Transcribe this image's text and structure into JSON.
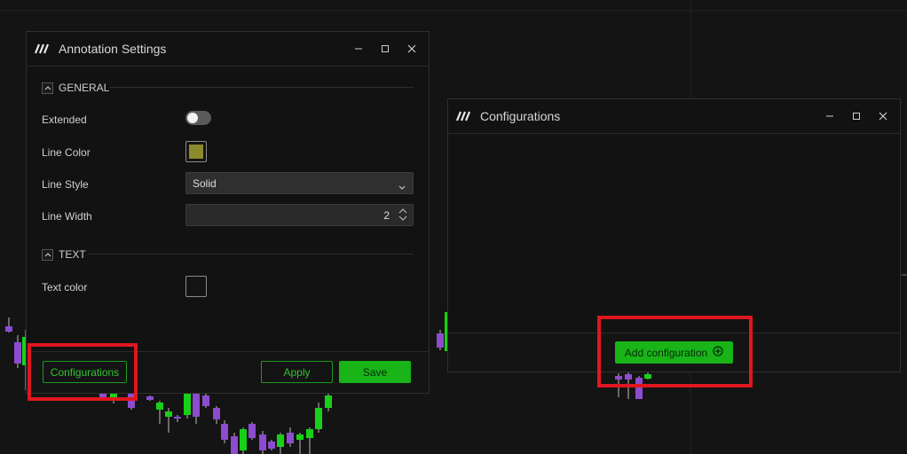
{
  "annotation_settings": {
    "title": "Annotation Settings",
    "logo_icon": "app-logo-icon",
    "sections": {
      "general": {
        "label": "GENERAL"
      },
      "text": {
        "label": "TEXT"
      }
    },
    "fields": {
      "extended": {
        "label": "Extended",
        "value": false
      },
      "line_color": {
        "label": "Line Color",
        "value": "#8d8a2e"
      },
      "line_style": {
        "label": "Line Style",
        "value": "Solid"
      },
      "line_width": {
        "label": "Line Width",
        "value": "2"
      },
      "text_color": {
        "label": "Text color",
        "value": "#141414"
      }
    },
    "footer": {
      "configurations_label": "Configurations",
      "apply_label": "Apply",
      "save_label": "Save"
    }
  },
  "configurations": {
    "title": "Configurations",
    "add_label": "Add configuration"
  },
  "colors": {
    "accent_green": "#18b418",
    "highlight_red": "#e0161f",
    "candle_up": "#19d019",
    "candle_down": "#8d4bd0"
  }
}
